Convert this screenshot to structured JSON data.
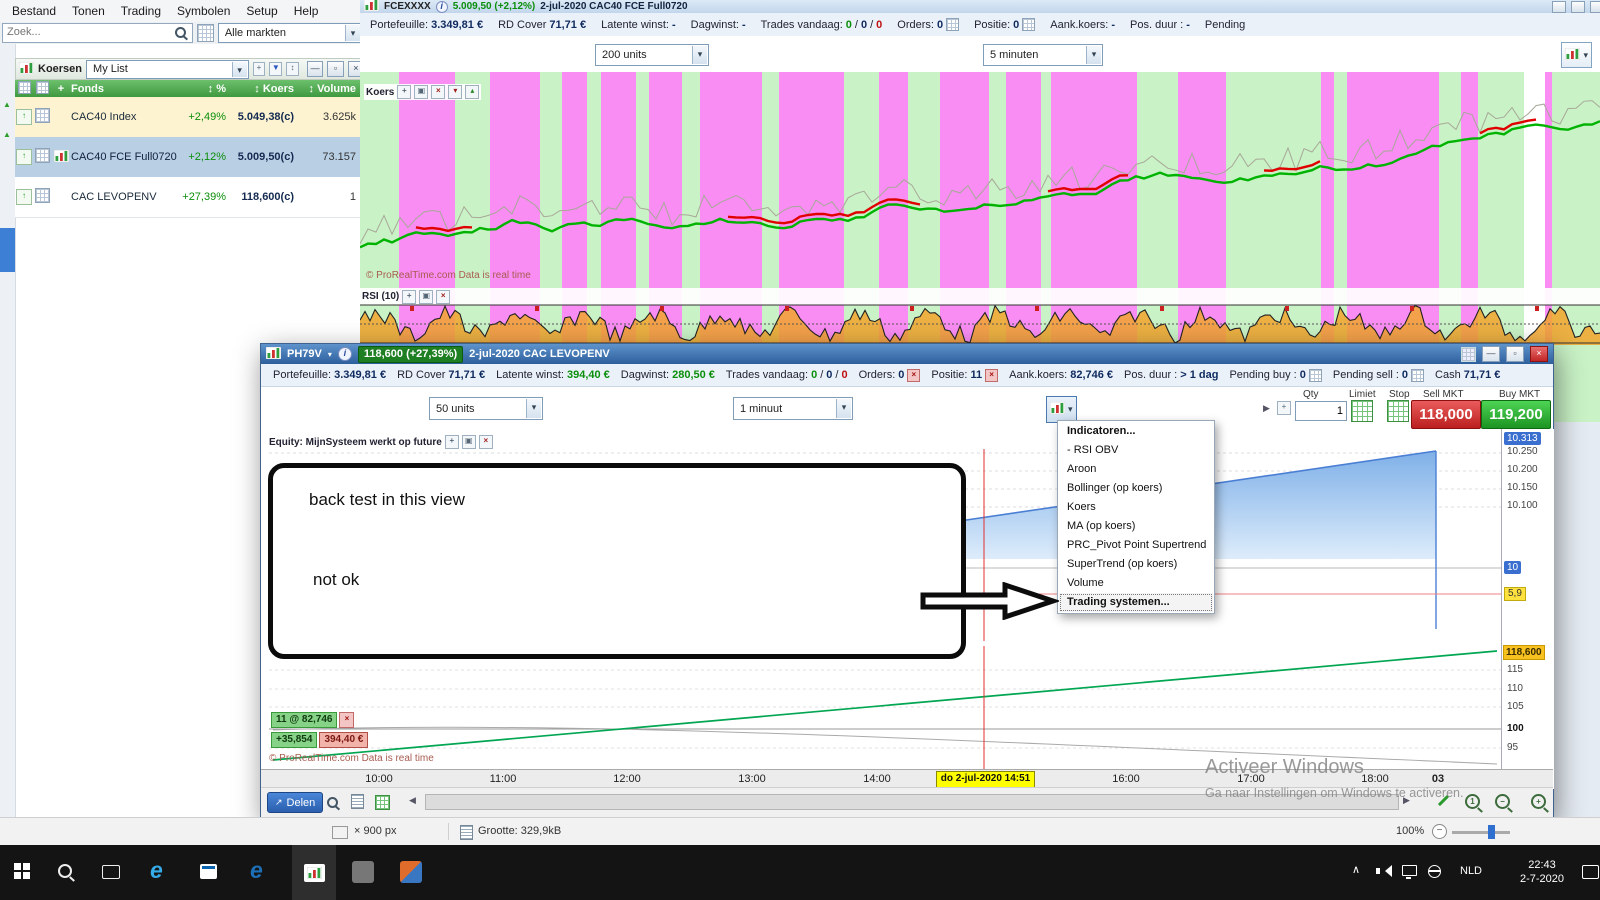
{
  "colors": {
    "band_magenta": "#f98df3",
    "band_green": "#c9f2c6",
    "up_green": "#00b300",
    "down_red": "#e00000",
    "sell_red": "#cc2d2d",
    "buy_green": "#23a927",
    "selection_blue": "#b9cfe4",
    "cursor_yellow": "#ffff00",
    "last_price_badge": "#f7c21f",
    "equity_blue": "#4a7fd4"
  },
  "menubar": {
    "items": [
      "Bestand",
      "Tonen",
      "Trading",
      "Symbolen",
      "Setup",
      "Help"
    ]
  },
  "search": {
    "placeholder": "Zoek...",
    "market_filter": "Alle markten"
  },
  "watchlist": {
    "title": "Koersen",
    "list_selector": "My List",
    "columns": {
      "fonds": "Fonds",
      "pct": "%",
      "koers": "Koers",
      "volume": "Volume"
    },
    "rows": [
      {
        "fonds": "CAC40 Index",
        "pct": "+2,49%",
        "koers": "5.049,38(c)",
        "volume": "3.625k"
      },
      {
        "fonds": "CAC40 FCE Full0720",
        "pct": "+2,12%",
        "koers": "5.009,50(c)",
        "volume": "73.157"
      },
      {
        "fonds": "CAC LEVOPENV",
        "pct": "+27,39%",
        "koers": "118,600(c)",
        "volume": "1"
      }
    ]
  },
  "bg_window": {
    "symbol": "FCEXXXX",
    "price": "5.009,50 (+2,12%)",
    "session": "2-jul-2020 CAC40 FCE Full0720",
    "stats": [
      {
        "label": "Portefeuille:",
        "value": "3.349,81 €"
      },
      {
        "label": "RD Cover",
        "value": "71,71 €"
      },
      {
        "label": "Latente winst:",
        "value": "-"
      },
      {
        "label": "Dagwinst:",
        "value": "-"
      },
      {
        "label": "Trades vandaag:"
      },
      {
        "label": "Orders:",
        "value": "0"
      },
      {
        "label": "Positie:",
        "value": "0"
      },
      {
        "label": "Aank.koers:",
        "value": "-"
      },
      {
        "label": "Pos. duur :",
        "value": "-"
      },
      {
        "label": "Pending",
        "value": ""
      }
    ],
    "trades": {
      "a": "0",
      "b": "0",
      "c": "0"
    },
    "units_selector": "200 units",
    "timeframe_selector": "5 minuten",
    "price_pane_label": "Koers",
    "rsi_pane_label": "RSI (10)",
    "copyright": "© ProRealTime.com Data is real time"
  },
  "main_window": {
    "symbol": "PH79V",
    "price_badge": "118,600 (+27,39%)",
    "session": "2-jul-2020 CAC LEVOPENV",
    "stats": [
      {
        "label": "Portefeuille:",
        "value": "3.349,81 €"
      },
      {
        "label": "RD Cover",
        "value": "71,71 €"
      },
      {
        "label": "Latente winst:",
        "value": "394,40 €"
      },
      {
        "label": "Dagwinst:",
        "value": "280,50 €"
      },
      {
        "label": "Trades vandaag:"
      },
      {
        "label": "Orders:",
        "value": "0"
      },
      {
        "label": "Positie:",
        "value": "11"
      },
      {
        "label": "Aank.koers:",
        "value": "82,746 €"
      },
      {
        "label": "Pos. duur :",
        "value": "> 1 dag"
      },
      {
        "label": "Pending buy :",
        "value": "0"
      },
      {
        "label": "Pending sell :",
        "value": "0"
      },
      {
        "label": "Cash",
        "value": "71,71 €"
      }
    ],
    "trades": {
      "a": "0",
      "b": "0",
      "c": "0"
    },
    "units_selector": "50 units",
    "timeframe_selector": "1 minuut",
    "equity_pane_label": "Equity: MijnSysteem werkt op future",
    "annotation": {
      "line1": "back test in this view",
      "line2": "not ok"
    },
    "indicator_menu": {
      "items": [
        "Indicatoren...",
        "- RSI OBV",
        "Aroon",
        "Bollinger (op koers)",
        "Koers",
        "MA (op koers)",
        "PRC_Pivot Point Supertrend",
        "SuperTrend (op koers)",
        "Volume",
        "Trading systemen..."
      ]
    },
    "order_ticket": {
      "qty_label": "Qty",
      "qty_value": "1",
      "limit_label": "Limiet",
      "stop_label": "Stop",
      "sell_label": "Sell MKT",
      "sell_price": "118,000",
      "buy_label": "Buy MKT",
      "buy_price": "119,200"
    },
    "equity_scale": {
      "top_badge": "10.313",
      "ticks": [
        "10.250",
        "10.200",
        "10.150",
        "10.100"
      ],
      "mid_badge": "10",
      "level_badge": "5,9"
    },
    "price_scale": {
      "last_badge": "118,600",
      "ticks": [
        "115",
        "110",
        "105",
        "100",
        "95"
      ]
    },
    "position_overlay": {
      "position": "11 @ 82,746",
      "points": "+35,854",
      "pnl": "394,40 €"
    },
    "time_axis": {
      "labels": [
        "10:00",
        "11:00",
        "12:00",
        "13:00",
        "14:00",
        "16:00",
        "17:00",
        "18:00",
        "03"
      ],
      "cursor": "do 2-jul-2020 14:51"
    },
    "copyright": "© ProRealTime.com Data is real time",
    "share_button": "Delen"
  },
  "statusbar": {
    "dimensions": "× 900 px",
    "size": "Grootte: 329,9kB",
    "zoom": "100%"
  },
  "taskbar": {
    "language": "NLD",
    "time": "22:43",
    "date": "2-7-2020"
  },
  "watermark": {
    "line1": "Activeer Windows",
    "line2": "Ga naar Instellingen om Windows te activeren."
  }
}
